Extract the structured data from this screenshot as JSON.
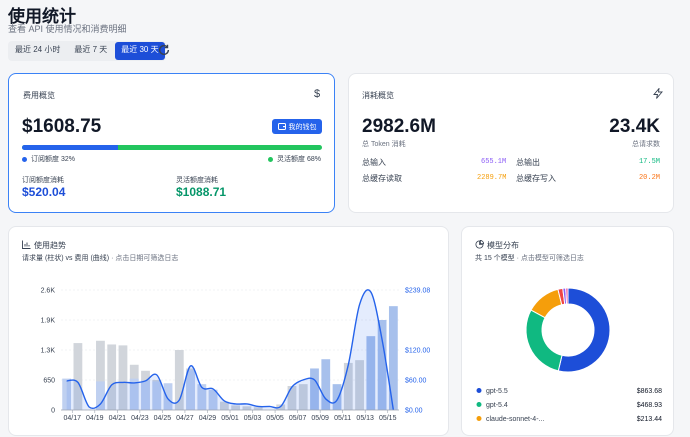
{
  "header": {
    "title": "使用统计",
    "subtitle": "查看 API 使用情况和消费明细"
  },
  "ranges": {
    "r24h": "最近 24 小时",
    "r7d": "最近 7 天",
    "r30d": "最近 30 天",
    "selected": "最近 30 天"
  },
  "cost": {
    "heading": "费用概览",
    "icon": "dollar-icon",
    "total": "$1608.75",
    "wallet_label": "我的钱包",
    "subscription_label": "订阅额度 32%",
    "flexible_label": "灵活额度 68%",
    "subscription_share": 0.32,
    "sub_used_label": "订阅额度消耗",
    "sub_used_value": "$520.04",
    "flex_used_label": "灵活额度消耗",
    "flex_used_value": "$1088.71",
    "colors": {
      "subscription": "#2563eb",
      "flexible": "#22c55e"
    }
  },
  "consumption": {
    "heading": "消耗概览",
    "icon": "zap-icon",
    "tokens_value": "2982.6M",
    "tokens_label": "总 Token 消耗",
    "requests_value": "23.4K",
    "requests_label": "总请求数",
    "input_label": "总输入",
    "input_value": "655.1M",
    "output_label": "总输出",
    "output_value": "17.5M",
    "cache_read_label": "总缓存读取",
    "cache_read_value": "2289.7M",
    "cache_write_label": "总缓存写入",
    "cache_write_value": "20.2M",
    "colors": {
      "input": "#8b5cf6",
      "output": "#10b981",
      "cache_read": "#f59e0b",
      "cache_write": "#f97316"
    }
  },
  "trend": {
    "heading": "使用趋势",
    "icon": "bar-chart-icon",
    "caption": "请求量 (柱状) vs 费用 (曲线)",
    "hint": "· 点击日期可筛选日志"
  },
  "distribution": {
    "heading": "模型分布",
    "icon": "pie-chart-icon",
    "caption": "共 15 个模型",
    "hint": "· 点击模型可筛选日志"
  },
  "chart_data": [
    {
      "type": "bar",
      "title": "",
      "x_tick_labels": [
        "04/17",
        "04/19",
        "04/21",
        "04/23",
        "04/25",
        "04/27",
        "04/29",
        "05/01",
        "05/03",
        "05/05",
        "05/07",
        "05/09",
        "05/11",
        "05/13",
        "05/15"
      ],
      "y_left_ticks": [
        "0",
        "650",
        "1.3K",
        "1.9K",
        "2.6K"
      ],
      "y_right_ticks": [
        "$0.00",
        "$60.00",
        "$120.00",
        "$239.08"
      ],
      "ylim_left": [
        0,
        2600
      ],
      "ylim_right": [
        0,
        239.08
      ],
      "grid": true,
      "series": [
        {
          "kind": "bar",
          "axis": "left",
          "color": "#d1d5db",
          "values": [
            0,
            1450,
            0,
            1500,
            1420,
            1400,
            980,
            850,
            650,
            420,
            1300,
            900,
            500,
            420,
            180,
            100,
            80,
            60,
            0,
            120,
            520,
            560,
            0,
            0,
            0,
            1020,
            1080,
            0,
            0,
            0
          ]
        },
        {
          "kind": "bar",
          "axis": "left",
          "color": "#bfd0f0",
          "values": [
            680,
            0,
            0,
            620,
            0,
            0,
            680,
            640,
            620,
            580,
            0,
            860,
            560,
            440,
            0,
            0,
            0,
            0,
            0,
            0,
            0,
            0,
            0,
            0,
            0,
            0,
            0,
            0,
            0,
            0
          ]
        },
        {
          "kind": "bar",
          "axis": "left",
          "color": "#a7c0ec",
          "values": [
            0,
            0,
            0,
            0,
            0,
            0,
            0,
            0,
            0,
            0,
            0,
            0,
            0,
            0,
            0,
            0,
            0,
            0,
            0,
            0,
            0,
            0,
            900,
            1100,
            560,
            0,
            0,
            1600,
            1950,
            2250
          ]
        },
        {
          "kind": "line",
          "axis": "right",
          "color": "#2563eb",
          "values": [
            58,
            55,
            6,
            12,
            50,
            55,
            54,
            58,
            70,
            22,
            20,
            88,
            45,
            42,
            18,
            12,
            12,
            7,
            7,
            7,
            46,
            60,
            60,
            22,
            20,
            90,
            210,
            235,
            140,
            0
          ]
        }
      ]
    },
    {
      "type": "pie",
      "title": "",
      "variant": "donut",
      "slices": [
        {
          "label": "gpt-5.5",
          "value": 863.68,
          "display": "$863.68",
          "color": "#1d4ed8"
        },
        {
          "label": "gpt-5.4",
          "value": 468.93,
          "display": "$468.93",
          "color": "#10b981"
        },
        {
          "label": "claude-sonnet-4-...",
          "value": 213.44,
          "display": "$213.44",
          "color": "#f59e0b"
        },
        {
          "label": "",
          "value": 30,
          "display": "",
          "color": "#ef4444"
        },
        {
          "label": "",
          "value": 18,
          "display": "",
          "color": "#8b5cf6"
        },
        {
          "label": "",
          "value": 14,
          "display": "",
          "color": "#ec4899"
        }
      ]
    }
  ]
}
